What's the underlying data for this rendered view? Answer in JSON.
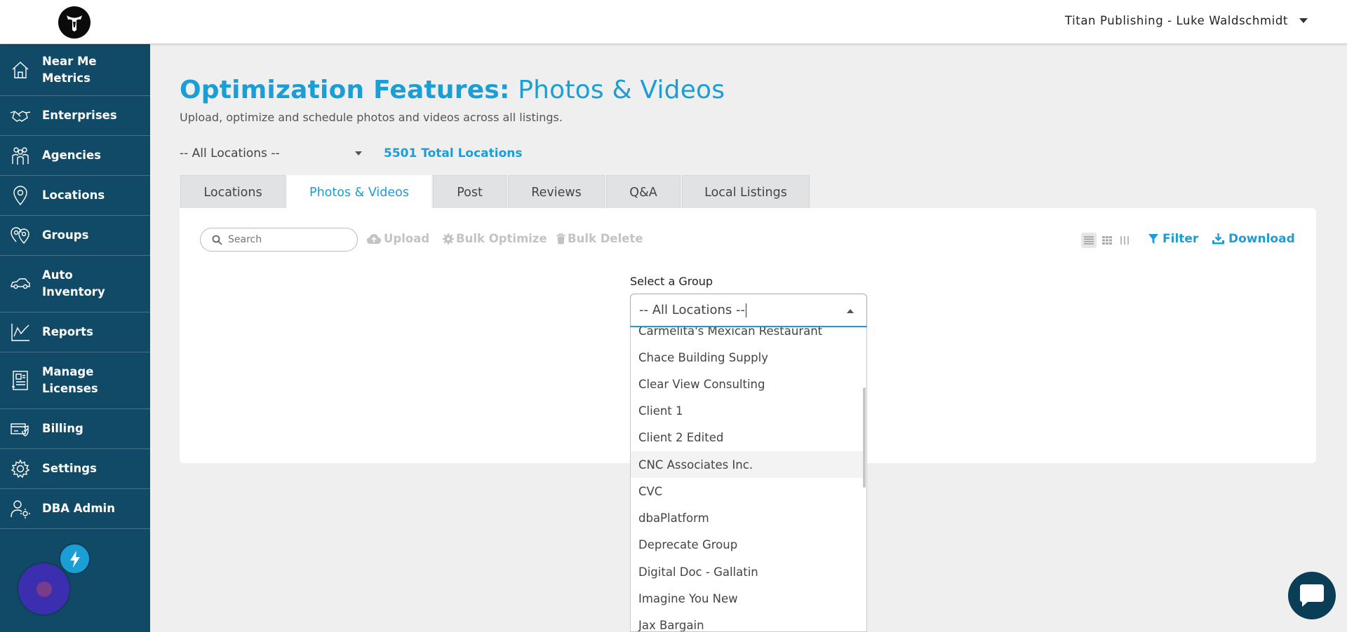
{
  "header": {
    "account_label": "Titan Publishing - Luke Waldschmidt"
  },
  "sidebar": {
    "items": [
      {
        "label": "Near Me\nMetrics",
        "icon": "home-icon"
      },
      {
        "label": "Enterprises",
        "icon": "handshake-icon"
      },
      {
        "label": "Agencies",
        "icon": "people-icon"
      },
      {
        "label": "Locations",
        "icon": "map-pin-icon"
      },
      {
        "label": "Groups",
        "icon": "pins-group-icon"
      },
      {
        "label": "Auto\nInventory",
        "icon": "car-icon"
      },
      {
        "label": "Reports",
        "icon": "chart-icon"
      },
      {
        "label": "Manage\nLicenses",
        "icon": "license-icon"
      },
      {
        "label": "Billing",
        "icon": "billing-icon"
      },
      {
        "label": "Settings",
        "icon": "gear-icon"
      },
      {
        "label": "DBA Admin",
        "icon": "admin-user-icon"
      }
    ]
  },
  "page": {
    "title_bold": "Optimization Features:",
    "title_light": "Photos & Videos",
    "subtitle": "Upload, optimize and schedule photos and videos across all listings.",
    "location_select_value": "-- All Locations --",
    "total_locations": "5501 Total Locations"
  },
  "tabs": [
    {
      "label": "Locations",
      "active": false
    },
    {
      "label": "Photos & Videos",
      "active": true
    },
    {
      "label": "Post",
      "active": false
    },
    {
      "label": "Reviews",
      "active": false
    },
    {
      "label": "Q&A",
      "active": false
    },
    {
      "label": "Local Listings",
      "active": false
    }
  ],
  "toolbar": {
    "search_placeholder": "Search",
    "upload_label": "Upload",
    "bulk_optimize_label": "Bulk Optimize",
    "bulk_delete_label": "Bulk Delete",
    "filter_label": "Filter",
    "download_label": "Download"
  },
  "group_select": {
    "label": "Select a Group",
    "value": "-- All Locations --",
    "options": [
      "Carmelita's Mexican Restaurant",
      "Chace Building Supply",
      "Clear View Consulting",
      "Client 1",
      "Client 2 Edited",
      "CNC Associates Inc.",
      "CVC",
      "dbaPlatform",
      "Deprecate Group",
      "Digital Doc - Gallatin",
      "Imagine You New",
      "Jax Bargain"
    ],
    "highlighted_option": "CNC Associates Inc."
  },
  "colors": {
    "accent": "#1b9ed6",
    "sidebar": "#114a66",
    "chat_button": "#0a3d56"
  }
}
